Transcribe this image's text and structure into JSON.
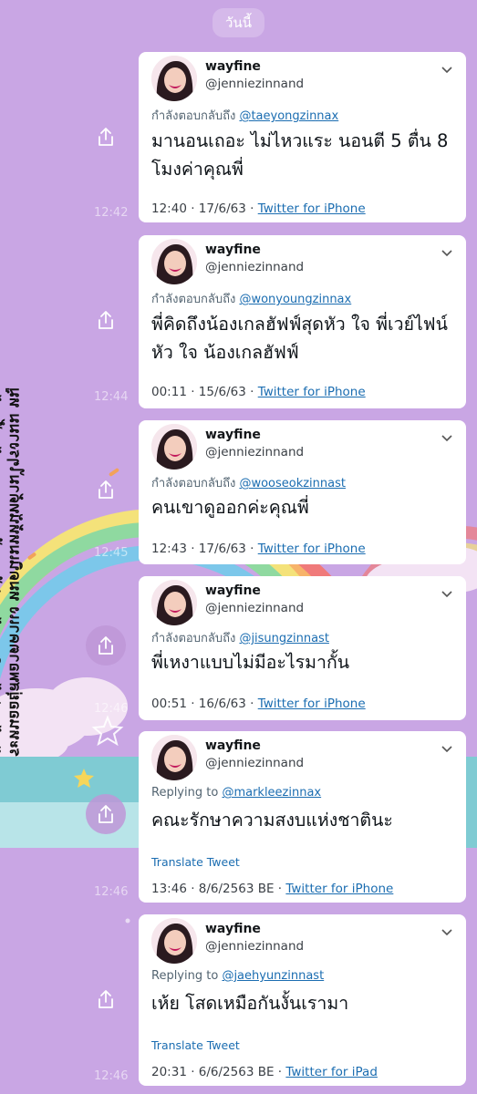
{
  "header": {
    "date_label": "วันนี้"
  },
  "caption": {
    "text": "ระหนออยุ่สพอาตคาเเง หมดนิเมหห้นัทด้ามไๆรงามม หมูนันห้นเร่สร้านรินแลร้อยสุ่งไปแนไยหรามมาเรม้ามไ้ ฮน้อ ไกหดหตหนห"
  },
  "tweets": [
    {
      "display_name": "wayfine",
      "handle": "@jenniezinnand",
      "reply_prefix": "กำลังตอบกลับถึง ",
      "reply_to": "@taeyongzinnax",
      "text": "มานอนเถอะ ไม่ไหวแระ นอนตี 5 ตื่น 8 โมงค่าคุณพี่",
      "date": "12:40 · 17/6/63 · ",
      "source": "Twitter for iPhone",
      "chat_time": "12:42"
    },
    {
      "display_name": "wayfine",
      "handle": "@jenniezinnand",
      "reply_prefix": "กำลังตอบกลับถึง ",
      "reply_to": "@wonyoungzinnax",
      "text": "พี่คิดถึงน้องเกลฮัฟฟ์สุดหัว ใจ พี่เวย์ไฟน์ หัว ใจ น้องเกลฮัฟฟ์",
      "date": "00:11 · 15/6/63 · ",
      "source": "Twitter for iPhone",
      "chat_time": "12:44"
    },
    {
      "display_name": "wayfine",
      "handle": "@jenniezinnand",
      "reply_prefix": "กำลังตอบกลับถึง ",
      "reply_to": "@wooseokzinnast",
      "text": "คนเขาดูออกค่ะคุณพี่",
      "date": "12:43 · 17/6/63 · ",
      "source": "Twitter for iPhone",
      "chat_time": "12:45"
    },
    {
      "display_name": "wayfine",
      "handle": "@jenniezinnand",
      "reply_prefix": "กำลังตอบกลับถึง ",
      "reply_to": "@jisungzinnast",
      "text": "พี่เหงาแบบไม่มีอะไรมากั้น",
      "date": "00:51 · 16/6/63 · ",
      "source": "Twitter for iPhone",
      "chat_time": "12:46"
    },
    {
      "display_name": "wayfine",
      "handle": "@jenniezinnand",
      "reply_prefix": "Replying to ",
      "reply_to": "@markleezinnax",
      "text": "คณะรักษาความสงบแห่งชาตินะ",
      "translate": "Translate Tweet",
      "date": "13:46 · 8/6/2563 BE · ",
      "source": "Twitter for iPhone",
      "chat_time": "12:46"
    },
    {
      "display_name": "wayfine",
      "handle": "@jenniezinnand",
      "reply_prefix": "Replying to ",
      "reply_to": "@jaehyunzinnast",
      "text": "เห้ย โสดเหมือกันงั้นเรามา",
      "translate": "Translate Tweet",
      "date": "20:31 · 6/6/2563 BE · ",
      "source": "Twitter for iPad",
      "chat_time": "12:46"
    }
  ],
  "icons": {
    "share": "share-icon",
    "chevron": "chevron-down-icon",
    "star": "star-icon"
  },
  "colors": {
    "background": "#c9a6e4",
    "link": "#1b6db1",
    "card": "#ffffff"
  }
}
